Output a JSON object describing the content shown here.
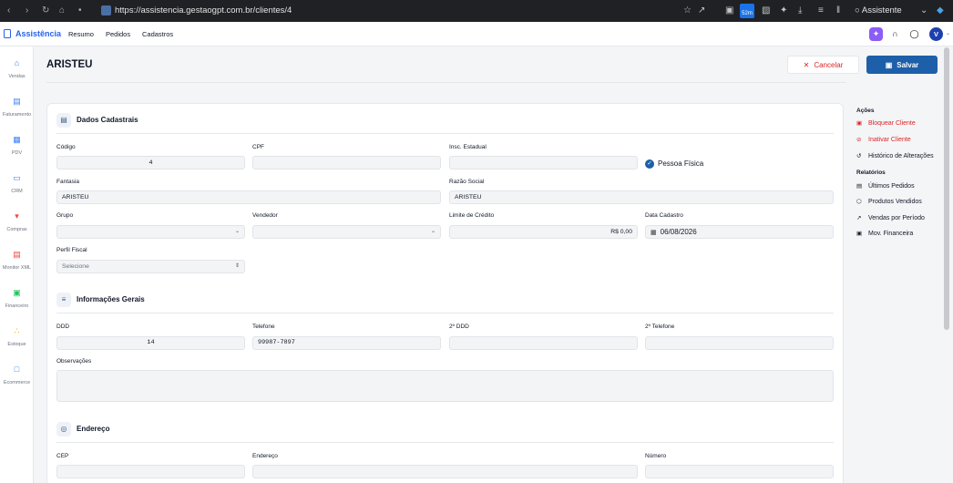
{
  "browser": {
    "url": "https://assistencia.gestaogpt.com.br/clientes/4",
    "timer_badge": "52m",
    "assistant_label": "Assistente"
  },
  "app": {
    "brand": "Assistência",
    "menu": [
      "Resumo",
      "Pedidos",
      "Cadastros"
    ],
    "avatar_initial": "V"
  },
  "sidebar": {
    "items": [
      {
        "label": "Vendas",
        "icon": "basket-icon",
        "color": "#3b82f6"
      },
      {
        "label": "Faturamento",
        "icon": "document-icon",
        "color": "#3b82f6"
      },
      {
        "label": "PDV",
        "icon": "store-icon",
        "color": "#3b82f6"
      },
      {
        "label": "CRM",
        "icon": "chat-icon",
        "color": "#3b82f6"
      },
      {
        "label": "Compras",
        "icon": "cart-icon",
        "color": "#ef4444"
      },
      {
        "label": "Monitor XML",
        "icon": "xml-file-icon",
        "color": "#ef4444"
      },
      {
        "label": "Financeiro",
        "icon": "money-icon",
        "color": "#22c55e"
      },
      {
        "label": "Estoque",
        "icon": "boxes-icon",
        "color": "#f59e0b"
      },
      {
        "label": "Ecommerce",
        "icon": "bag-icon",
        "color": "#3b82f6"
      }
    ]
  },
  "header": {
    "title": "ARISTEU",
    "cancel_label": "Cancelar",
    "save_label": "Salvar"
  },
  "sections": {
    "dados": {
      "title": "Dados Cadastrais",
      "codigo_label": "Código",
      "codigo_value": "4",
      "cpf_label": "CPF",
      "cpf_value": "",
      "insc_label": "Insc. Estadual",
      "insc_value": "",
      "pessoa_label": "Pessoa Física",
      "pessoa_checked": true,
      "fantasia_label": "Fantasia",
      "fantasia_value": "ARISTEU",
      "razao_label": "Razão Social",
      "razao_value": "ARISTEU",
      "grupo_label": "Grupo",
      "grupo_value": "",
      "vendedor_label": "Vendedor",
      "vendedor_value": "",
      "limite_label": "Limite de Crédito",
      "limite_value": "R$ 0,00",
      "data_label": "Data Cadastro",
      "data_value": "06/08/2026",
      "perfil_label": "Perfil Fiscal",
      "perfil_placeholder": "Selecione"
    },
    "gerais": {
      "title": "Informações Gerais",
      "ddd_label": "DDD",
      "ddd_value": "14",
      "tel_label": "Telefone",
      "tel_value": "99987-7897",
      "ddd2_label": "2º DDD",
      "ddd2_value": "",
      "tel2_label": "2º Telefone",
      "tel2_value": "",
      "obs_label": "Observações",
      "obs_value": ""
    },
    "endereco": {
      "title": "Endereço",
      "cep_label": "CEP",
      "endereco_label": "Endereço",
      "numero_label": "Número"
    }
  },
  "right_panel": {
    "acoes_title": "Ações",
    "acoes": [
      {
        "label": "Bloquear Cliente",
        "danger": true
      },
      {
        "label": "Inativar Cliente",
        "danger": true
      },
      {
        "label": "Histórico de Alterações",
        "danger": false
      }
    ],
    "relatorios_title": "Relatórios",
    "relatorios": [
      "Últimos Pedidos",
      "Produtos Vendidos",
      "Vendas por Período",
      "Mov. Financeira"
    ]
  }
}
